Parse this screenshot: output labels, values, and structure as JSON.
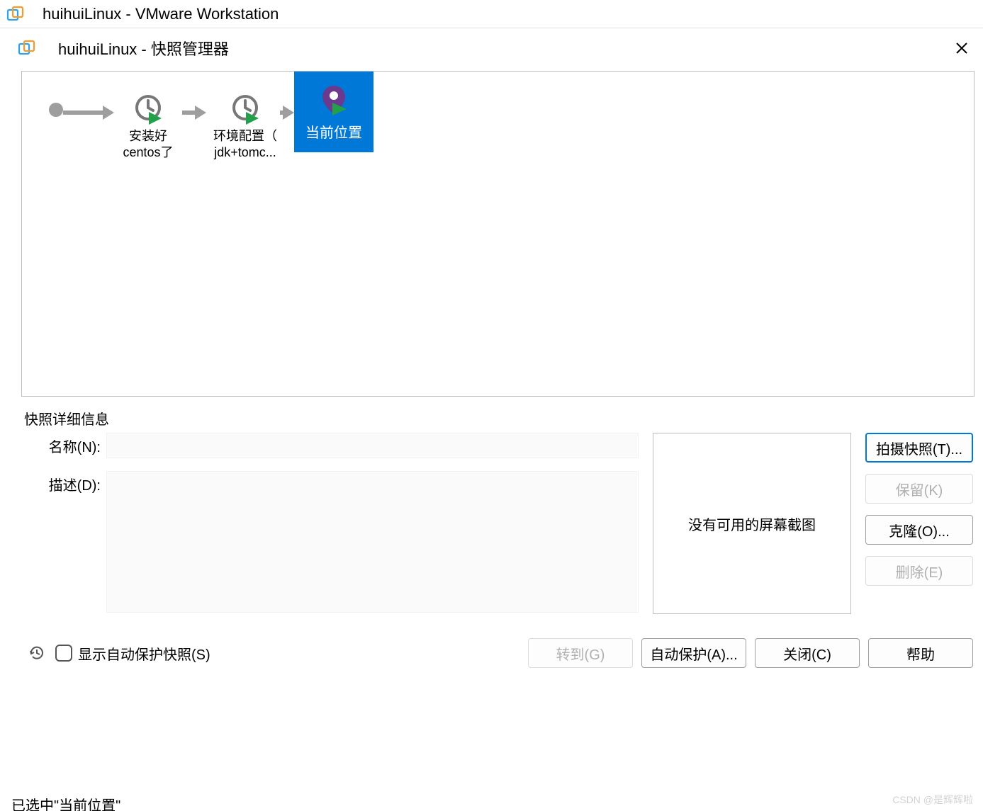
{
  "app": {
    "title": "huihuiLinux - VMware Workstation"
  },
  "dialog": {
    "title": "huihuiLinux - 快照管理器",
    "tree": {
      "snapshots": [
        {
          "label_line1": "安装好",
          "label_line2": "centos了"
        },
        {
          "label_line1": "环境配置（",
          "label_line2": "jdk+tomc..."
        }
      ],
      "current_label": "当前位置"
    },
    "details": {
      "section_label": "快照详细信息",
      "name_label": "名称(N):",
      "name_value": "",
      "desc_label": "描述(D):",
      "desc_value": "",
      "thumb_text": "没有可用的屏幕截图"
    },
    "side_buttons": {
      "take": "拍摄快照(T)...",
      "keep": "保留(K)",
      "clone": "克隆(O)...",
      "delete": "删除(E)"
    },
    "bottom": {
      "autoprotect_checkbox_label": "显示自动保护快照(S)",
      "goto": "转到(G)",
      "autoprotect_btn": "自动保护(A)...",
      "close": "关闭(C)",
      "help": "帮助"
    },
    "status_partial": "已选中\"当前位置\""
  },
  "watermark": "CSDN @是辉辉啦"
}
